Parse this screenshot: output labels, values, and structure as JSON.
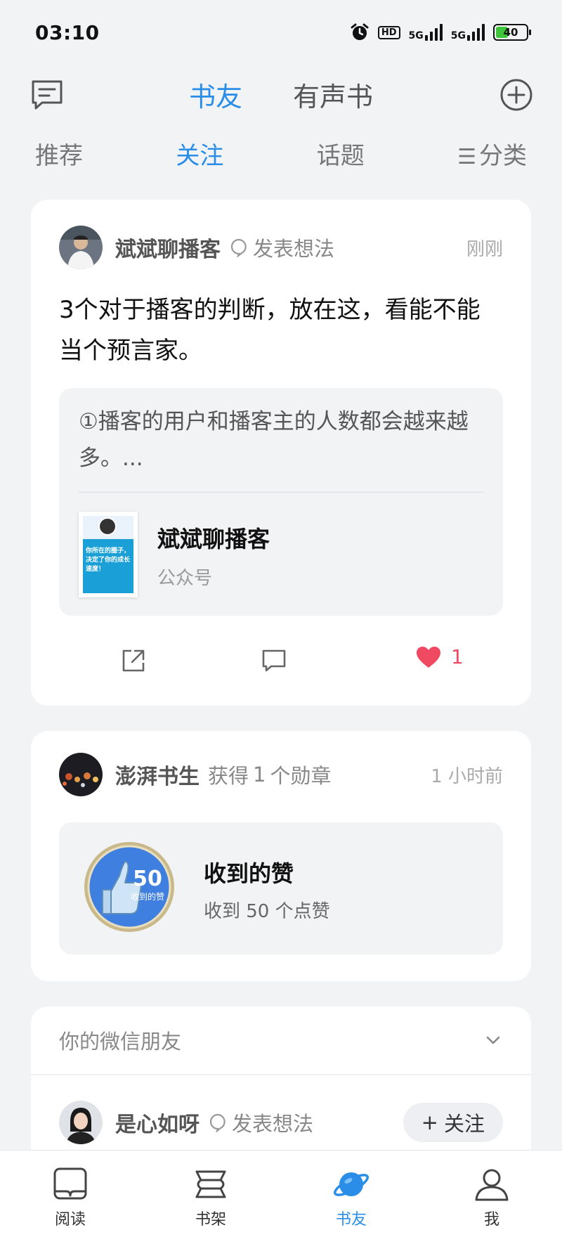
{
  "status_bar": {
    "time": "03:10",
    "hd": "HD",
    "signal1": "5G",
    "signal2": "5G",
    "battery": "40",
    "battery_level": 0.4,
    "icons": [
      "alarm-icon",
      "hd-icon",
      "signal-icon",
      "signal-icon",
      "battery-icon"
    ]
  },
  "header": {
    "tabs": [
      {
        "label": "书友",
        "active": true
      },
      {
        "label": "有声书",
        "active": false
      }
    ],
    "left_icon": "message-icon",
    "right_icon": "plus-circle-icon"
  },
  "sub_tabs": [
    {
      "label": "推荐",
      "active": false
    },
    {
      "label": "关注",
      "active": true
    },
    {
      "label": "话题",
      "active": false
    },
    {
      "label": "分类",
      "icon": "menu-icon",
      "active": false
    }
  ],
  "feed": {
    "post1": {
      "user": "斌斌聊播客",
      "action": "发表想法",
      "time": "刚刚",
      "text": "3个对于播客的判断，放在这，看能不能当个预言家。",
      "quote": "①播客的用户和播客主的人数都会越来越多。...",
      "book": {
        "title": "斌斌聊播客",
        "subtitle": "公众号",
        "cover_text": "你所在的圈子，决定了你的成长速度！"
      },
      "likes": "1"
    },
    "post2": {
      "user": "澎湃书生",
      "action_prefix": "获得",
      "action_count": "1",
      "action_suffix": "个勋章",
      "time": "1 小时前",
      "badge_title": "收到的赞",
      "badge_desc": "收到 50 个点赞",
      "medal_number": "50",
      "medal_caption": "收到的赞"
    },
    "friends": {
      "title": "你的微信朋友",
      "row": {
        "user": "是心如呀",
        "action": "发表想法",
        "follow": "关注"
      }
    }
  },
  "bottom_nav": [
    {
      "label": "阅读",
      "icon": "book-icon",
      "active": false
    },
    {
      "label": "书架",
      "icon": "bookshelf-icon",
      "active": false
    },
    {
      "label": "书友",
      "icon": "planet-icon",
      "active": true
    },
    {
      "label": "我",
      "icon": "person-icon",
      "active": false
    }
  ],
  "colors": {
    "accent": "#2a8ee8",
    "like": "#f04a63",
    "background": "#f2f3f5"
  }
}
